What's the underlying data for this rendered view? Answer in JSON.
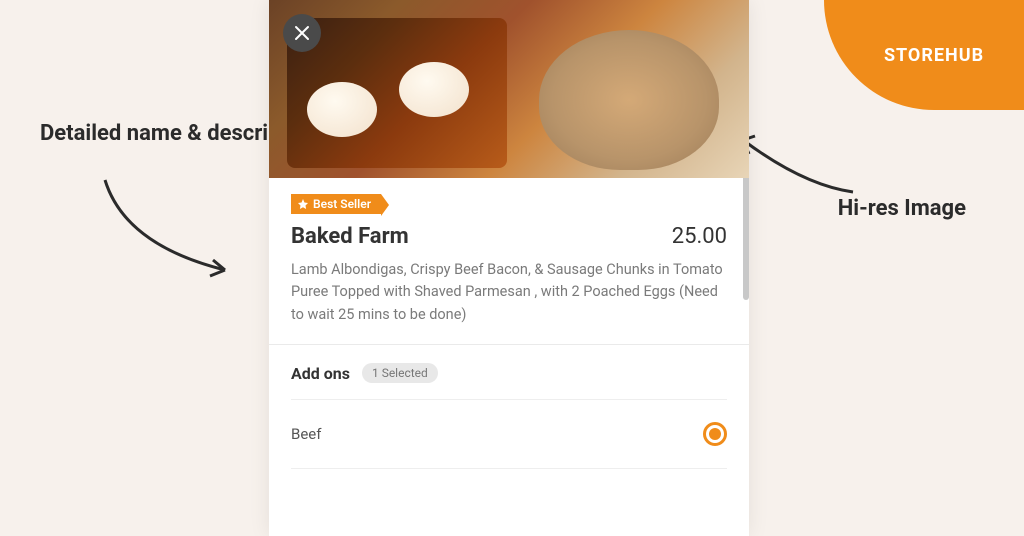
{
  "brand": "STOREHUB",
  "annotations": {
    "left": "Detailed name & description",
    "right": "Hi-res Image"
  },
  "item": {
    "badge_label": "Best Seller",
    "title": "Baked Farm",
    "price": "25.00",
    "description": "Lamb Albondigas, Crispy Beef Bacon, & Sausage Chunks in Tomato Puree Topped with Shaved Parmesan , with 2 Poached Eggs (Need to wait 25 mins to be done)"
  },
  "addons": {
    "section_title": "Add ons",
    "selected_pill": "1 Selected",
    "options": [
      {
        "name": "Beef",
        "selected": true
      }
    ]
  }
}
